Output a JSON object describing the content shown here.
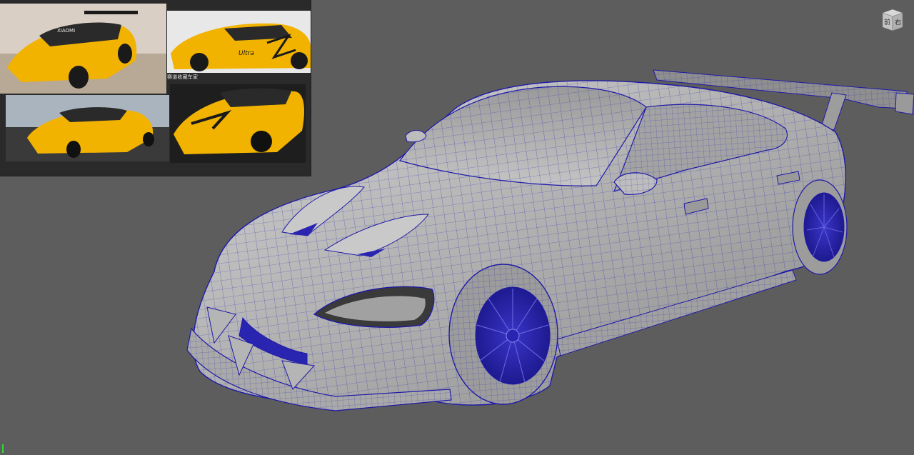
{
  "viewport": {
    "background": "#5d5d5d",
    "wire_color": "#1f1aa8",
    "mesh_surface": "#b8b8b8"
  },
  "reference_panel": {
    "caption": "赛道收藏车家",
    "brand_text": "XIAOMI",
    "livery_text": "Ultra",
    "accent_color": "#f2b300"
  },
  "viewcube": {
    "front_label": "前",
    "right_label": "右"
  }
}
